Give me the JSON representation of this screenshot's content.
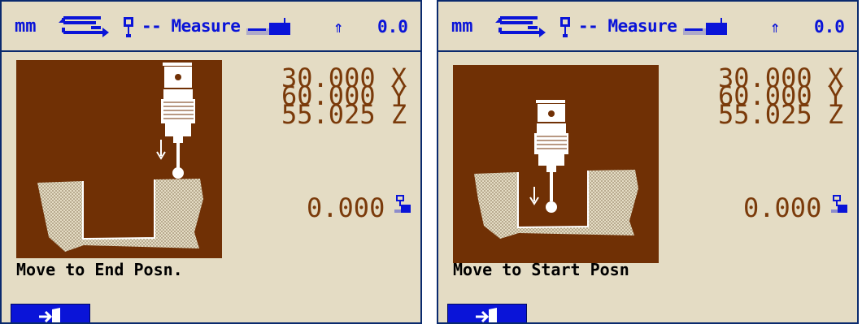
{
  "left": {
    "header": {
      "unit": "mm",
      "mode": "Measure",
      "up_arrow": "⇑",
      "value": "0.0"
    },
    "coords": [
      {
        "value": "30.000",
        "axis": "X"
      },
      {
        "value": "60.000",
        "axis": "Y"
      },
      {
        "value": "55.025",
        "axis": "Z"
      }
    ],
    "readout": "0.000",
    "message": "Move to End Posn.",
    "icons": [
      "direction-arrows-icon",
      "probe-icon",
      "ruler-icon",
      "probe-depth-icon",
      "exit-door-icon"
    ]
  },
  "right": {
    "header": {
      "unit": "mm",
      "mode": "Measure",
      "up_arrow": "⇑",
      "value": "0.0"
    },
    "coords": [
      {
        "value": "30.000",
        "axis": "X"
      },
      {
        "value": "60.000",
        "axis": "Y"
      },
      {
        "value": "55.025",
        "axis": "Z"
      }
    ],
    "readout": "0.000",
    "message": "Move to Start Posn",
    "icons": [
      "direction-arrows-icon",
      "probe-icon",
      "ruler-icon",
      "probe-depth-icon",
      "exit-door-icon"
    ]
  },
  "colors": {
    "background": "#e4dcc4",
    "header_text": "#0a14d8",
    "diagram_bg": "#703005",
    "coord_text": "#7a3a0a",
    "button": "#0a14d8",
    "border": "#0a2a6e"
  }
}
